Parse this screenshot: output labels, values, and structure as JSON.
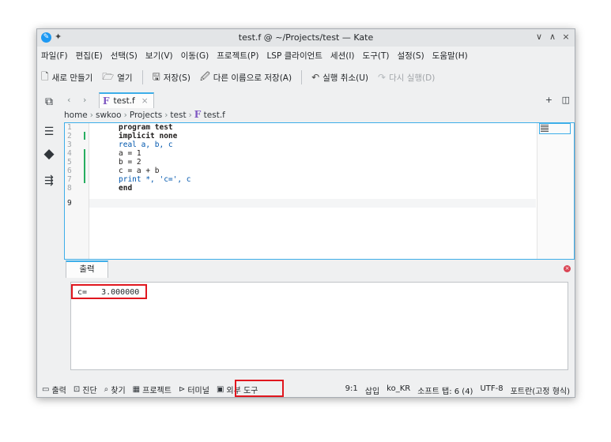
{
  "window": {
    "title": "test.f @ ~/Projects/test — Kate",
    "controls": [
      "∨",
      "∧",
      "×"
    ]
  },
  "menu": [
    "파일(F)",
    "편집(E)",
    "선택(S)",
    "보기(V)",
    "이동(G)",
    "프로젝트(P)",
    "LSP 클라이언트",
    "세션(I)",
    "도구(T)",
    "설정(S)",
    "도움말(H)"
  ],
  "toolbar": {
    "new": "새로 만들기",
    "open": "열기",
    "save": "저장(S)",
    "save_as": "다른 이름으로 저장(A)",
    "undo": "실행 취소(U)",
    "redo": "다시 실행(D)"
  },
  "tab": {
    "label": "test.f",
    "icon": "F"
  },
  "breadcrumb": [
    "home",
    "swkoo",
    "Projects",
    "test",
    "test.f"
  ],
  "editor": {
    "line_numbers": [
      "1",
      "2",
      "3",
      "4",
      "5",
      "6",
      "7",
      "8",
      "9"
    ],
    "code": [
      "program test",
      "implicit none",
      "real a, b, c",
      "a = 1",
      "b = 2",
      "c = a + b",
      "print *, 'c=', c",
      "end",
      ""
    ]
  },
  "panel": {
    "tab_label": "출력",
    "output": "c=   3.000000"
  },
  "status": {
    "left": [
      "출력",
      "진단",
      "찾기",
      "프로젝트",
      "터미널",
      "외부 도구"
    ],
    "position": "9:1",
    "mode": "삽입",
    "language": "ko_KR",
    "tabs": "소프트 탭: 6 (4)",
    "encoding": "UTF-8",
    "filetype": "포트란(고정 형식)"
  },
  "colors": {
    "accent": "#3daee9",
    "highlight": "#e0161e",
    "modified": "#27ae60"
  }
}
